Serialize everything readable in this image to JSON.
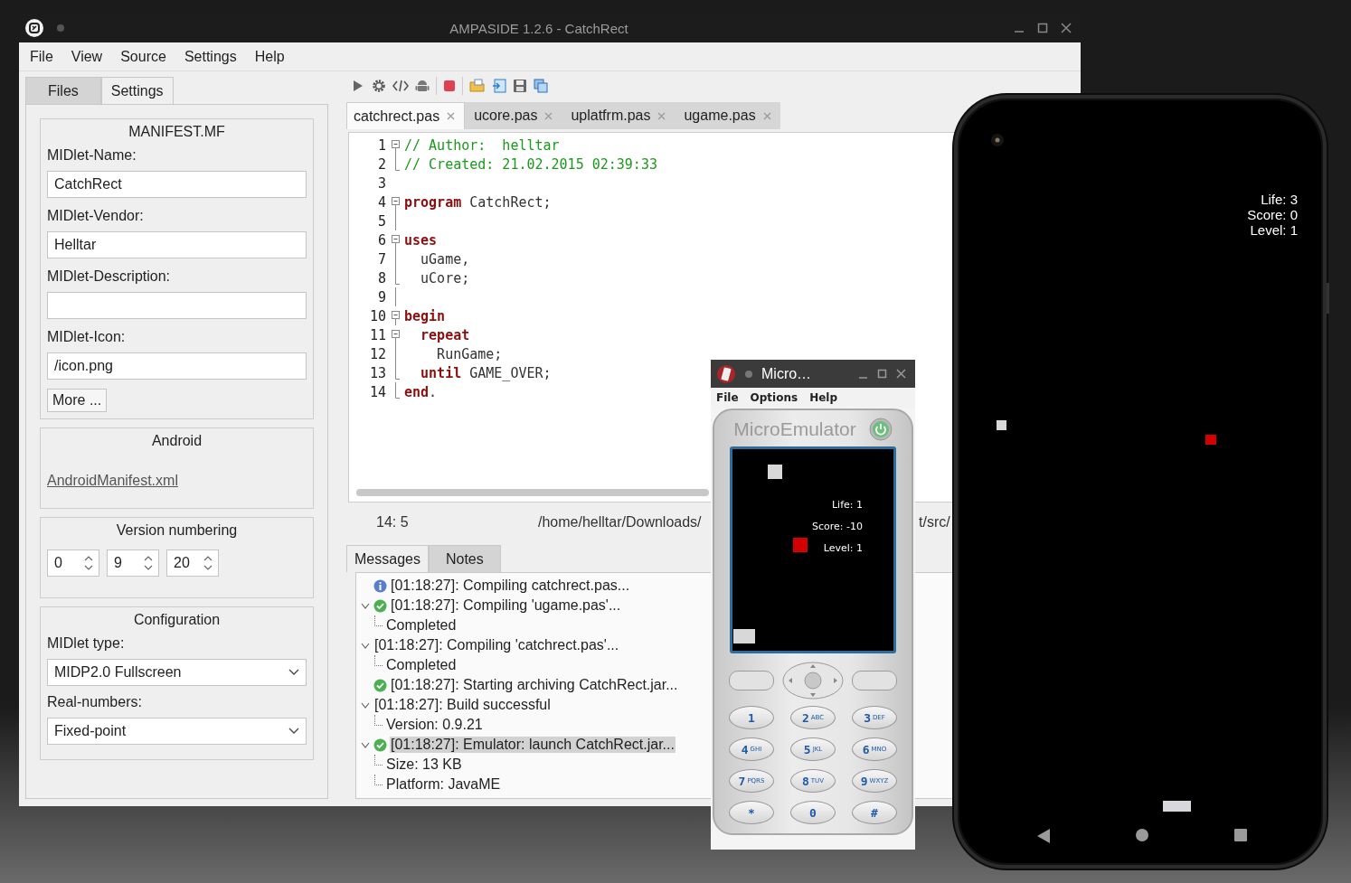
{
  "window": {
    "title": "AMPASIDE 1.2.6 - CatchRect"
  },
  "menu": [
    "File",
    "View",
    "Source",
    "Settings",
    "Help"
  ],
  "side_tabs": [
    {
      "label": "Files",
      "selected": false
    },
    {
      "label": "Settings",
      "selected": true
    }
  ],
  "manifest": {
    "title": "MANIFEST.MF",
    "fields": [
      {
        "label": "MIDlet-Name:",
        "value": "CatchRect"
      },
      {
        "label": "MIDlet-Vendor:",
        "value": "Helltar"
      },
      {
        "label": "MIDlet-Description:"
      },
      {
        "label": "MIDlet-Icon:",
        "value": "/icon.png"
      }
    ],
    "more_button": "More ..."
  },
  "android": {
    "title": "Android",
    "link": "AndroidManifest.xml"
  },
  "version": {
    "title": "Version numbering",
    "parts": [
      "0",
      "9",
      "20"
    ]
  },
  "configuration": {
    "title": "Configuration",
    "fields": [
      {
        "label": "MIDlet type:",
        "value": "MIDP2.0 Fullscreen"
      },
      {
        "label": "Real-numbers:",
        "value": "Fixed-point"
      }
    ]
  },
  "editor_tabs": [
    {
      "label": "catchrect.pas",
      "selected": true
    },
    {
      "label": "ucore.pas",
      "selected": false
    },
    {
      "label": "uplatfrm.pas",
      "selected": false
    },
    {
      "label": "ugame.pas",
      "selected": false
    }
  ],
  "code_lines": [
    {
      "number": "1",
      "kind": "start",
      "tokens": [
        {
          "kind": "comment",
          "text": "// Author:  helltar"
        }
      ]
    },
    {
      "number": "2",
      "kind": "end",
      "tokens": [
        {
          "kind": "comment",
          "text": "// Created: 21.02.2015 02:39:33"
        }
      ]
    },
    {
      "number": "3",
      "kind": "none"
    },
    {
      "number": "4",
      "kind": "start",
      "tokens": [
        {
          "kind": "keyword",
          "text": "program"
        },
        {
          "kind": "plain",
          "text": " CatchRect;"
        }
      ]
    },
    {
      "number": "5",
      "kind": "inner"
    },
    {
      "number": "6",
      "kind": "start",
      "tokens": [
        {
          "kind": "keyword",
          "text": "uses"
        }
      ]
    },
    {
      "number": "7",
      "kind": "inner",
      "tokens": [
        {
          "kind": "plain",
          "text": "  uGame,"
        }
      ]
    },
    {
      "number": "8",
      "kind": "end",
      "tokens": [
        {
          "kind": "plain",
          "text": "  uCore;"
        }
      ]
    },
    {
      "number": "9",
      "kind": "inner"
    },
    {
      "number": "10",
      "kind": "start",
      "tokens": [
        {
          "kind": "keyword",
          "text": "begin"
        }
      ]
    },
    {
      "number": "11",
      "kind": "start",
      "tokens": [
        {
          "kind": "keyword",
          "text": "  repeat"
        }
      ]
    },
    {
      "number": "12",
      "kind": "inner",
      "tokens": [
        {
          "kind": "plain",
          "text": "    RunGame;"
        }
      ]
    },
    {
      "number": "13",
      "kind": "end",
      "tokens": [
        {
          "kind": "keyword",
          "text": "  until"
        },
        {
          "kind": "plain",
          "text": " GAME_OVER;"
        }
      ]
    },
    {
      "number": "14",
      "kind": "end",
      "tokens": [
        {
          "kind": "keyword",
          "text": "end"
        },
        {
          "kind": "plain",
          "text": "."
        }
      ]
    }
  ],
  "status_bar": {
    "position": "14: 5",
    "path_start": "/home/helltar/Downloads/",
    "path_end": "t/src/"
  },
  "bottom_tabs": [
    {
      "label": "Messages",
      "selected": true
    },
    {
      "label": "Notes",
      "selected": false
    }
  ],
  "messages": [
    {
      "kind": "info",
      "text": "[01:18:27]: Compiling catchrect.pas...",
      "selected": false
    },
    {
      "kind": "success",
      "text": "[01:18:27]: Compiling 'ugame.pas'...",
      "selected": false,
      "children": [
        {
          "text": "Completed",
          "selected": false
        }
      ]
    },
    {
      "kind": "none",
      "text": "[01:18:27]: Compiling 'catchrect.pas'...",
      "selected": false,
      "children": [
        {
          "text": "Completed",
          "selected": false
        }
      ]
    },
    {
      "kind": "success",
      "text": "[01:18:27]: Starting archiving CatchRect.jar...",
      "selected": false
    },
    {
      "kind": "none",
      "text": "[01:18:27]: Build successful",
      "selected": false,
      "children": [
        {
          "text": "Version: 0.9.21",
          "selected": false
        }
      ]
    },
    {
      "kind": "success",
      "text": "[01:18:27]: Emulator: launch CatchRect.jar...",
      "selected": true,
      "children": [
        {
          "text": "Size: 13 KB",
          "selected": false
        },
        {
          "text": "Platform: JavaME",
          "selected": false
        }
      ]
    }
  ],
  "emulator": {
    "title": "Micro…",
    "menu": [
      "File",
      "Options",
      "Help"
    ],
    "brand": "MicroEmulator",
    "screen_lines": [
      "Life: 1",
      "Score: -10",
      "Level: 1"
    ],
    "keys": [
      {
        "digit": "1"
      },
      {
        "digit": "2",
        "letters": "ABC"
      },
      {
        "digit": "3",
        "letters": "DEF"
      },
      {
        "digit": "4",
        "letters": "GHI"
      },
      {
        "digit": "5",
        "letters": "JKL"
      },
      {
        "digit": "6",
        "letters": "MNO"
      },
      {
        "digit": "7",
        "letters": "PQRS"
      },
      {
        "digit": "8",
        "letters": "TUV"
      },
      {
        "digit": "9",
        "letters": "WXYZ"
      },
      {
        "digit": "*"
      },
      {
        "digit": "0"
      },
      {
        "digit": "#"
      }
    ]
  },
  "android_phone": {
    "screen_lines": [
      "Life: 3",
      "Score: 0",
      "Level: 1"
    ]
  }
}
